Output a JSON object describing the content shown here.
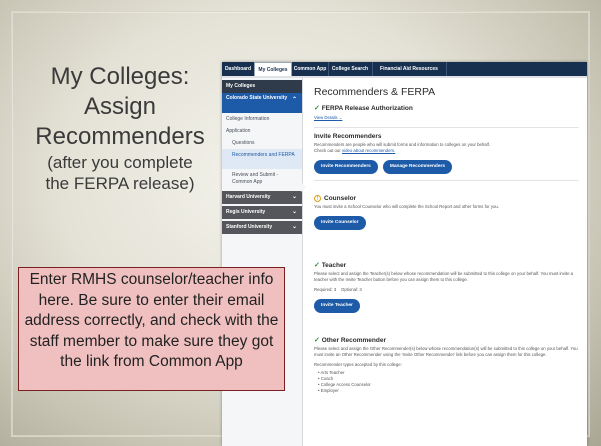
{
  "slide": {
    "title_lines": [
      "My Colleges:",
      "Assign",
      "Recommenders"
    ],
    "subtitle_lines": [
      "(after you complete",
      "the FERPA release)"
    ],
    "note": "Enter RMHS counselor/teacher info here. Be sure to enter their email address correctly, and check with the staff member to make sure they got the link from Common App"
  },
  "nav": {
    "tabs": [
      "Dashboard",
      "My Colleges",
      "Common App",
      "College Search",
      "Financial Aid Resources"
    ]
  },
  "sidebar": {
    "header": "My Colleges",
    "selected_college": "Colorado State University",
    "items": [
      "College Information",
      "Application",
      "Questions",
      "Recommenders and FERPA",
      "Review and Submit - Common App"
    ],
    "other_colleges": [
      "Harvard University",
      "Regis University",
      "Stanford University"
    ]
  },
  "main": {
    "title": "Recommenders & FERPA",
    "ferpa": {
      "heading": "FERPA Release Authorization",
      "link": "View Details"
    },
    "invite": {
      "heading": "Invite Recommenders",
      "text": "Recommenders are people who will submit forms and information to colleges on your behalf.",
      "text2": "Check out our",
      "video_link": "video about recommenders.",
      "btn_invite": "Invite Recommenders",
      "btn_manage": "Manage Recommenders"
    },
    "counselor": {
      "heading": "Counselor",
      "text": "You must invite a School Counselor who will complete the School Report and other forms for you.",
      "btn": "Invite Counselor"
    },
    "teacher": {
      "heading": "Teacher",
      "text": "Please select and assign the Teacher(s) below whose recommendation will be submitted to this college on your behalf. You must invite a teacher with the Invite Teacher button before you can assign them to this college.",
      "required": "Required: 3",
      "optional": "Optional: 3",
      "btn": "Invite Teacher"
    },
    "other": {
      "heading": "Other Recommender",
      "text": "Please select and assign the Other Recommender(s) below whose recommendation(s) will be submitted to this college on your behalf. You must invite an Other Recommender using the 'Invite Other Recommender' link before you can assign them for this college.",
      "accepted": "Recommender types accepted by this college:",
      "types": [
        "Arts Teacher",
        "Coach",
        "College Access Counselor",
        "Employer"
      ]
    }
  },
  "icons": {
    "check": "check-icon",
    "warning": "warning-icon",
    "chevron": "chevron-down-icon"
  },
  "colors": {
    "accent": "#1d5ba8",
    "nav": "#173050",
    "note_bg": "#f0c0c0",
    "note_border": "#7a2020"
  }
}
